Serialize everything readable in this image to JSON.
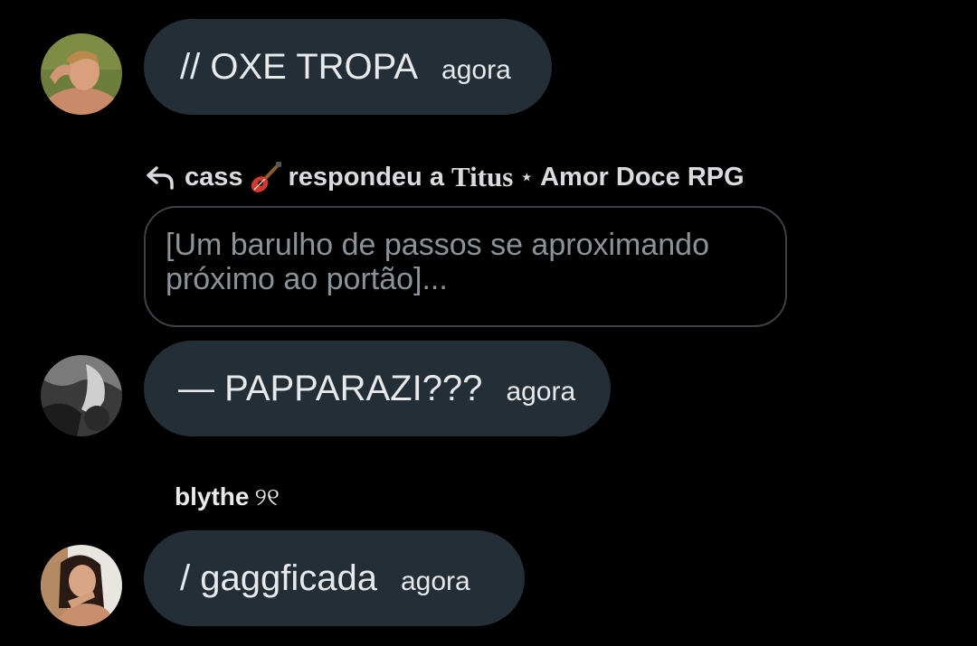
{
  "messages": [
    {
      "text": "// OXE TROPA",
      "time": "agora"
    },
    {
      "text": "— PAPPARAZI???",
      "time": "agora"
    },
    {
      "text": "/ gaggficada",
      "time": "agora"
    }
  ],
  "reply": {
    "user": "cass",
    "action": "respondeu a",
    "target": "Titus",
    "separator": "⋆",
    "community": "Amor Doce RPG",
    "quote": "[Um barulho de passos se aproximando próximo ao portão]..."
  },
  "sender": {
    "name": "blythe",
    "decoration": "୨୧"
  },
  "icons": {
    "reply": "reply-arrow-icon",
    "guitar": "guitar-emoji-icon"
  },
  "colors": {
    "background": "#000000",
    "bubble": "#232e36",
    "text": "#e7e9ea",
    "quote_text": "#8b9399",
    "quote_border": "#3b4248"
  }
}
